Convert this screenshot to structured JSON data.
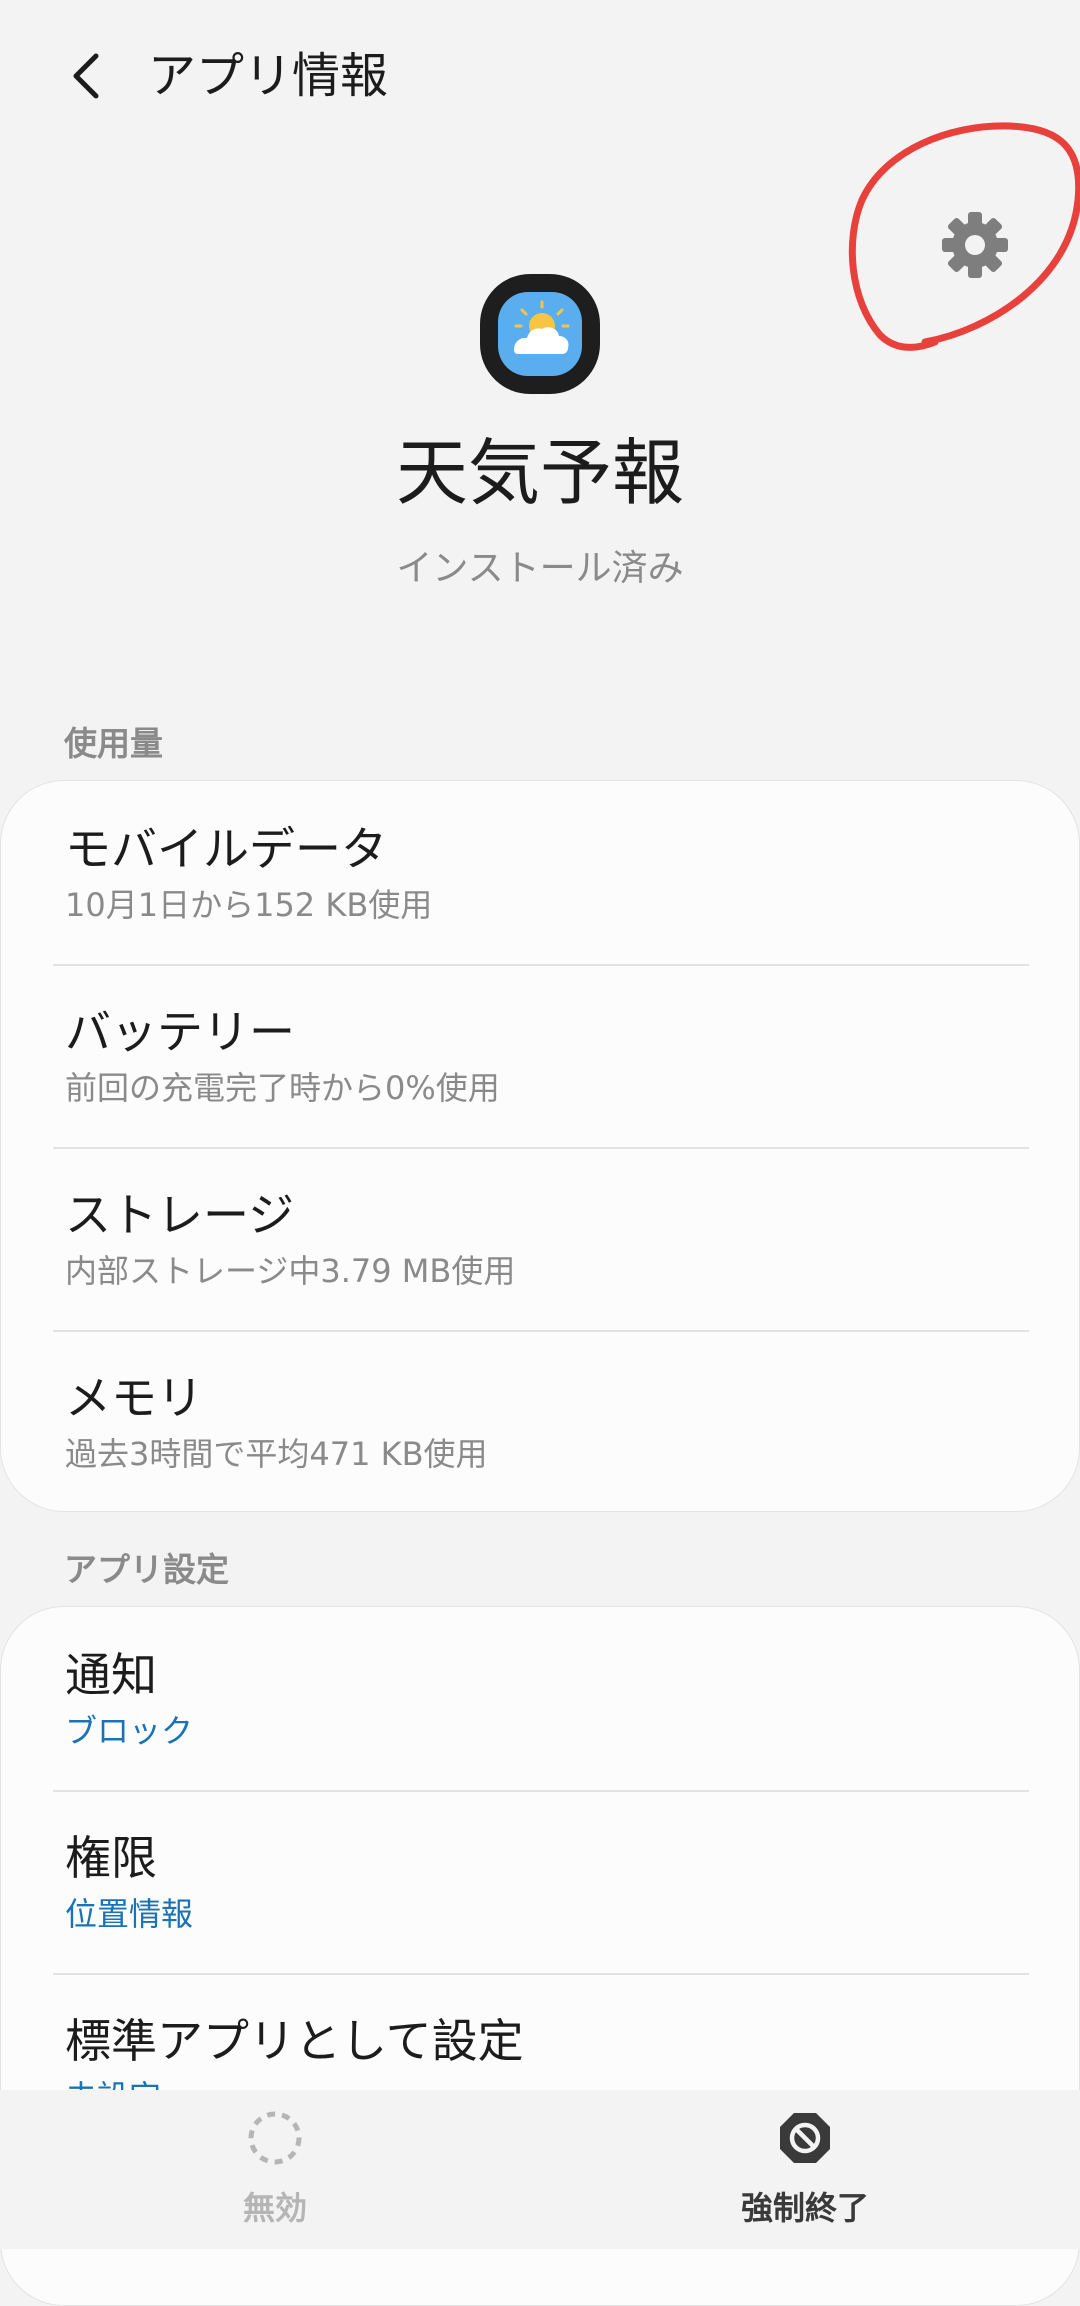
{
  "header": {
    "title": "アプリ情報"
  },
  "app": {
    "name": "天気予報",
    "status": "インストール済み"
  },
  "sections": {
    "usage": {
      "label": "使用量",
      "items": [
        {
          "title": "モバイルデータ",
          "subtitle": "10月1日から152 KB使用"
        },
        {
          "title": "バッテリー",
          "subtitle": "前回の充電完了時から0%使用"
        },
        {
          "title": "ストレージ",
          "subtitle": "内部ストレージ中3.79 MB使用"
        },
        {
          "title": "メモリ",
          "subtitle": "過去3時間で平均471 KB使用"
        }
      ]
    },
    "app_settings": {
      "label": "アプリ設定",
      "items": [
        {
          "title": "通知",
          "subtitle": "ブロック"
        },
        {
          "title": "権限",
          "subtitle": "位置情報"
        },
        {
          "title": "標準アプリとして設定",
          "subtitle": "未設定"
        }
      ]
    }
  },
  "bottom_bar": {
    "disable_label": "無効",
    "force_stop_label": "強制終了"
  },
  "colors": {
    "background": "#f3f3f3",
    "card": "#fcfcfc",
    "link_blue": "#1a73b6",
    "annotation_red": "#e8413c",
    "icon_sky": "#5aaef0"
  },
  "icons": {
    "back": "chevron-left-icon",
    "settings": "gear-icon",
    "app": "weather-icon",
    "disable": "dashed-circle-icon",
    "force_stop": "stop-icon"
  }
}
